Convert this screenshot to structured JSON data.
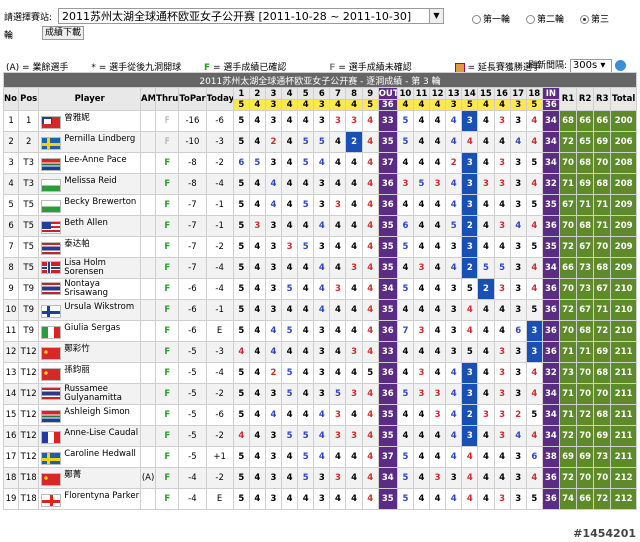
{
  "header": {
    "select_label": "請選擇賽站:",
    "event_selected": "2011苏州太湖全球通杯欧亚女子公开赛 [2011-10-28 ~ 2011-10-30]",
    "round_suffix": "輪",
    "download_label": "成績下載",
    "radios": [
      {
        "label": "第一輪",
        "checked": false
      },
      {
        "label": "第二輪",
        "checked": false
      },
      {
        "label": "第三",
        "checked": true
      }
    ]
  },
  "legend": {
    "amateur": "(A) = 業餘選手",
    "back_nine": "* = 選手從後九洞開球",
    "confirmed_mark": "F",
    "confirmed": "= 選手成績已確認",
    "unconfirmed_mark": "F",
    "unconfirmed": "= 選手成績未確認",
    "playoff": "= 延長賽獲勝選手",
    "refresh_label": "刷新間隔:",
    "refresh_value": "300s"
  },
  "table": {
    "caption": "2011苏州太湖全球通杯欧亚女子公开赛 - 逐洞成績 - 第 3 輪",
    "columns": {
      "no": "No.",
      "pos": "Pos",
      "player": "Player",
      "am": "AM",
      "thru": "Thru",
      "topar": "ToPar",
      "today": "Today",
      "out": "OUT",
      "in": "IN",
      "r1": "R1",
      "r2": "R2",
      "r3": "R3",
      "total": "Total"
    },
    "holes": [
      "1",
      "2",
      "3",
      "4",
      "5",
      "6",
      "7",
      "8",
      "9",
      "10",
      "11",
      "12",
      "13",
      "14",
      "15",
      "16",
      "17",
      "18"
    ],
    "pars": [
      "5",
      "4",
      "3",
      "4",
      "4",
      "3",
      "4",
      "4",
      "5",
      "4",
      "4",
      "4",
      "3",
      "5",
      "4",
      "4",
      "3",
      "5"
    ],
    "par_out": "36",
    "par_in": "36",
    "rows": [
      {
        "no": "1",
        "pos": "1",
        "flag": "tw",
        "name": "曾雅妮",
        "am": "",
        "thru": "F",
        "thru_confirmed": false,
        "topar": "-16",
        "today": "-6",
        "holes": [
          "5",
          "4",
          "3",
          "4",
          "4",
          "3",
          "3",
          "3",
          "4",
          "5",
          "4",
          "4",
          "4",
          "3",
          "4",
          "3",
          "3",
          "4"
        ],
        "out": "33",
        "in": "34",
        "r1": "68",
        "r2": "66",
        "r3": "66",
        "total": "200"
      },
      {
        "no": "2",
        "pos": "2",
        "flag": "se",
        "name": "Pernilla Lindberg",
        "am": "",
        "thru": "F",
        "thru_confirmed": false,
        "topar": "-10",
        "today": "-3",
        "holes": [
          "5",
          "4",
          "2",
          "4",
          "5",
          "5",
          "4",
          "2",
          "4",
          "5",
          "4",
          "4",
          "4",
          "4",
          "4",
          "4",
          "4",
          "4"
        ],
        "out": "35",
        "in": "34",
        "r1": "72",
        "r2": "65",
        "r3": "69",
        "total": "206"
      },
      {
        "no": "3",
        "pos": "T3",
        "flag": "za",
        "name": "Lee-Anne Pace",
        "am": "",
        "thru": "F",
        "thru_confirmed": true,
        "topar": "-8",
        "today": "-2",
        "holes": [
          "6",
          "5",
          "3",
          "4",
          "5",
          "4",
          "4",
          "4",
          "4",
          "4",
          "4",
          "4",
          "2",
          "3",
          "4",
          "3",
          "3",
          "5"
        ],
        "out": "37",
        "in": "34",
        "r1": "70",
        "r2": "68",
        "r3": "70",
        "total": "208"
      },
      {
        "no": "4",
        "pos": "T3",
        "flag": "wl",
        "name": "Melissa Reid",
        "am": "",
        "thru": "F",
        "thru_confirmed": true,
        "topar": "-8",
        "today": "-4",
        "holes": [
          "5",
          "4",
          "4",
          "4",
          "4",
          "3",
          "4",
          "4",
          "4",
          "3",
          "5",
          "3",
          "4",
          "3",
          "3",
          "3",
          "3",
          "4"
        ],
        "out": "36",
        "in": "32",
        "r1": "71",
        "r2": "69",
        "r3": "68",
        "total": "208"
      },
      {
        "no": "5",
        "pos": "T5",
        "flag": "wl",
        "name": "Becky Brewerton",
        "am": "",
        "thru": "F",
        "thru_confirmed": true,
        "topar": "-7",
        "today": "-1",
        "holes": [
          "5",
          "4",
          "4",
          "4",
          "5",
          "3",
          "3",
          "4",
          "4",
          "4",
          "4",
          "4",
          "4",
          "3",
          "4",
          "4",
          "3",
          "5"
        ],
        "out": "36",
        "in": "35",
        "r1": "67",
        "r2": "71",
        "r3": "71",
        "total": "209"
      },
      {
        "no": "6",
        "pos": "T5",
        "flag": "us",
        "name": "Beth Allen",
        "am": "",
        "thru": "F",
        "thru_confirmed": true,
        "topar": "-7",
        "today": "-1",
        "holes": [
          "5",
          "3",
          "3",
          "4",
          "4",
          "4",
          "4",
          "4",
          "4",
          "6",
          "4",
          "4",
          "5",
          "2",
          "4",
          "3",
          "4",
          "4"
        ],
        "out": "35",
        "in": "36",
        "r1": "70",
        "r2": "68",
        "r3": "71",
        "total": "209"
      },
      {
        "no": "7",
        "pos": "T5",
        "flag": "th",
        "name": "泰达帕",
        "am": "",
        "thru": "F",
        "thru_confirmed": true,
        "topar": "-7",
        "today": "-2",
        "holes": [
          "5",
          "4",
          "3",
          "3",
          "5",
          "3",
          "4",
          "4",
          "4",
          "5",
          "4",
          "4",
          "3",
          "3",
          "4",
          "4",
          "3",
          "5"
        ],
        "out": "35",
        "in": "35",
        "r1": "72",
        "r2": "67",
        "r3": "70",
        "total": "209"
      },
      {
        "no": "8",
        "pos": "T5",
        "flag": "no",
        "name": "Lisa Holm Sorensen",
        "am": "",
        "thru": "F",
        "thru_confirmed": true,
        "topar": "-7",
        "today": "-4",
        "holes": [
          "5",
          "4",
          "3",
          "4",
          "4",
          "4",
          "4",
          "3",
          "4",
          "4",
          "3",
          "4",
          "4",
          "2",
          "5",
          "5",
          "3",
          "4"
        ],
        "out": "35",
        "in": "34",
        "r1": "66",
        "r2": "73",
        "r3": "68",
        "total": "209"
      },
      {
        "no": "9",
        "pos": "T9",
        "flag": "th",
        "name": "Nontaya Srisawang",
        "am": "",
        "thru": "F",
        "thru_confirmed": true,
        "topar": "-6",
        "today": "-4",
        "holes": [
          "5",
          "4",
          "3",
          "5",
          "4",
          "4",
          "3",
          "4",
          "4",
          "5",
          "4",
          "4",
          "3",
          "5",
          "2",
          "3",
          "3",
          "4"
        ],
        "out": "34",
        "in": "36",
        "r1": "70",
        "r2": "73",
        "r3": "67",
        "total": "210"
      },
      {
        "no": "10",
        "pos": "T9",
        "flag": "fi",
        "name": "Ursula Wikstrom",
        "am": "",
        "thru": "F",
        "thru_confirmed": true,
        "topar": "-6",
        "today": "-1",
        "holes": [
          "5",
          "4",
          "3",
          "4",
          "4",
          "4",
          "4",
          "4",
          "4",
          "4",
          "4",
          "4",
          "3",
          "4",
          "4",
          "4",
          "3",
          "5"
        ],
        "out": "35",
        "in": "36",
        "r1": "72",
        "r2": "67",
        "r3": "71",
        "total": "210"
      },
      {
        "no": "11",
        "pos": "T9",
        "flag": "it",
        "name": "Giulia Sergas",
        "am": "",
        "thru": "F",
        "thru_confirmed": true,
        "topar": "-6",
        "today": "E",
        "holes": [
          "5",
          "4",
          "4",
          "5",
          "4",
          "3",
          "4",
          "4",
          "4",
          "7",
          "3",
          "4",
          "3",
          "4",
          "4",
          "4",
          "6",
          "3"
        ],
        "out": "36",
        "in": "36",
        "r1": "70",
        "r2": "68",
        "r3": "72",
        "total": "210"
      },
      {
        "no": "12",
        "pos": "T12",
        "flag": "cn",
        "name": "鄭彩竹",
        "am": "",
        "thru": "F",
        "thru_confirmed": true,
        "topar": "-5",
        "today": "-3",
        "holes": [
          "4",
          "4",
          "4",
          "4",
          "4",
          "3",
          "4",
          "3",
          "4",
          "4",
          "4",
          "4",
          "3",
          "5",
          "4",
          "3",
          "3",
          "3"
        ],
        "out": "33",
        "in": "36",
        "r1": "71",
        "r2": "71",
        "r3": "69",
        "total": "211"
      },
      {
        "no": "13",
        "pos": "T12",
        "flag": "cn",
        "name": "孫鈞丽",
        "am": "",
        "thru": "F",
        "thru_confirmed": true,
        "topar": "-5",
        "today": "-4",
        "holes": [
          "5",
          "4",
          "2",
          "5",
          "4",
          "3",
          "4",
          "4",
          "5",
          "4",
          "3",
          "4",
          "4",
          "3",
          "4",
          "3",
          "3",
          "4"
        ],
        "out": "36",
        "in": "32",
        "r1": "73",
        "r2": "70",
        "r3": "68",
        "total": "211"
      },
      {
        "no": "14",
        "pos": "T12",
        "flag": "th",
        "name": "Russamee Gulyanamitta",
        "am": "",
        "thru": "F",
        "thru_confirmed": true,
        "topar": "-5",
        "today": "-2",
        "holes": [
          "5",
          "4",
          "3",
          "5",
          "4",
          "3",
          "5",
          "3",
          "4",
          "5",
          "3",
          "3",
          "4",
          "3",
          "4",
          "3",
          "3",
          "4"
        ],
        "out": "36",
        "in": "34",
        "r1": "71",
        "r2": "70",
        "r3": "70",
        "total": "211"
      },
      {
        "no": "15",
        "pos": "T12",
        "flag": "za",
        "name": "Ashleigh Simon",
        "am": "",
        "thru": "F",
        "thru_confirmed": true,
        "topar": "-5",
        "today": "-6",
        "holes": [
          "5",
          "4",
          "4",
          "4",
          "4",
          "4",
          "3",
          "4",
          "4",
          "4",
          "4",
          "3",
          "4",
          "2",
          "3",
          "3",
          "2",
          "5"
        ],
        "out": "35",
        "in": "34",
        "r1": "71",
        "r2": "72",
        "r3": "68",
        "total": "211"
      },
      {
        "no": "16",
        "pos": "T12",
        "flag": "fr",
        "name": "Anne-Lise Caudal",
        "am": "",
        "thru": "F",
        "thru_confirmed": true,
        "topar": "-5",
        "today": "-2",
        "holes": [
          "4",
          "4",
          "3",
          "5",
          "5",
          "4",
          "3",
          "3",
          "4",
          "4",
          "4",
          "4",
          "4",
          "3",
          "4",
          "3",
          "4",
          "4"
        ],
        "out": "35",
        "in": "34",
        "r1": "72",
        "r2": "70",
        "r3": "69",
        "total": "211"
      },
      {
        "no": "17",
        "pos": "T12",
        "flag": "se",
        "name": "Caroline Hedwall",
        "am": "",
        "thru": "F",
        "thru_confirmed": true,
        "topar": "-5",
        "today": "+1",
        "holes": [
          "5",
          "4",
          "3",
          "4",
          "5",
          "4",
          "4",
          "4",
          "4",
          "5",
          "4",
          "4",
          "4",
          "4",
          "4",
          "4",
          "3",
          "6"
        ],
        "out": "37",
        "in": "38",
        "r1": "69",
        "r2": "69",
        "r3": "73",
        "total": "211"
      },
      {
        "no": "18",
        "pos": "T18",
        "flag": "cn",
        "name": "鄭菁",
        "am": "(A)",
        "thru": "F",
        "thru_confirmed": true,
        "topar": "-4",
        "today": "-2",
        "holes": [
          "5",
          "4",
          "3",
          "4",
          "5",
          "3",
          "3",
          "4",
          "4",
          "5",
          "4",
          "3",
          "3",
          "4",
          "4",
          "4",
          "3",
          "4"
        ],
        "out": "34",
        "in": "36",
        "r1": "72",
        "r2": "70",
        "r3": "70",
        "total": "212"
      },
      {
        "no": "19",
        "pos": "T18",
        "flag": "en",
        "name": "Florentyna Parker",
        "am": "",
        "thru": "F",
        "thru_confirmed": true,
        "topar": "-4",
        "today": "E",
        "holes": [
          "5",
          "4",
          "3",
          "4",
          "4",
          "3",
          "4",
          "4",
          "4",
          "5",
          "4",
          "4",
          "4",
          "4",
          "4",
          "3",
          "3",
          "5"
        ],
        "out": "35",
        "in": "36",
        "r1": "74",
        "r2": "66",
        "r3": "72",
        "total": "212"
      }
    ]
  },
  "watermark": "#1454201"
}
